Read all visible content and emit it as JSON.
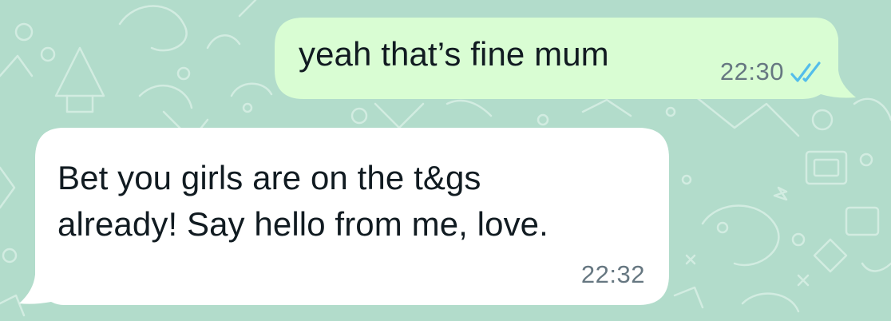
{
  "theme": {
    "chat_background": "#b2dccb",
    "outgoing_bubble": "#d9fdd3",
    "incoming_bubble": "#ffffff",
    "read_receipt": "#53bdeb"
  },
  "messages": [
    {
      "direction": "outgoing",
      "text": "yeah that’s fine mum",
      "time": "22:30",
      "status_icon": "double-check-read-icon"
    },
    {
      "direction": "incoming",
      "lines": [
        "Bet you girls are on the t&gs",
        "already! Say hello from me, love."
      ],
      "time": "22:32"
    }
  ]
}
